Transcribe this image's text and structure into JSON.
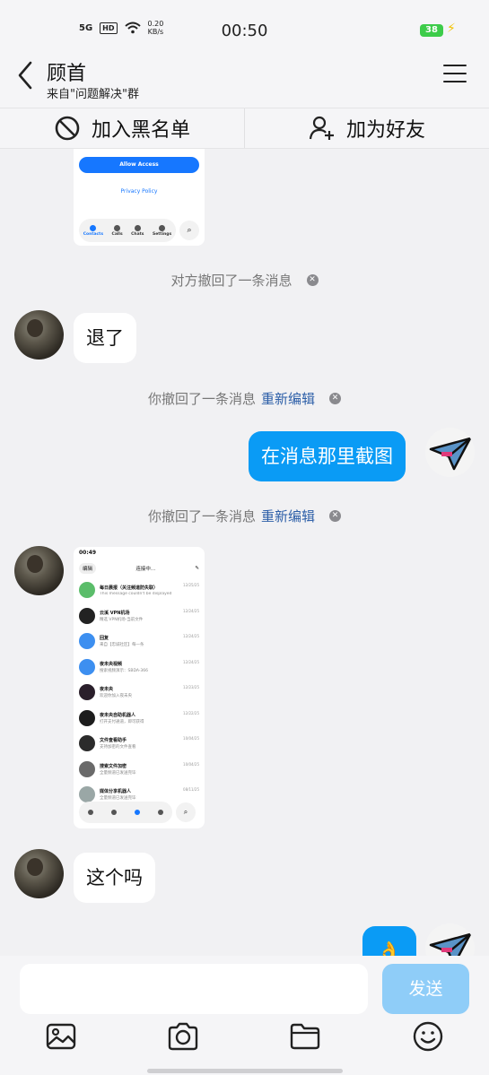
{
  "status_bar": {
    "network": "5G",
    "hd": "HD",
    "net_speed_value": "0.20",
    "net_speed_unit": "KB/s",
    "time": "00:50",
    "battery": "38"
  },
  "header": {
    "title": "顾首",
    "subtitle": "来自\"问题解决\"群"
  },
  "actions": {
    "block": "加入黑名单",
    "add_friend": "加为好友"
  },
  "messages": {
    "thumb1": {
      "allow_button": "Allow Access",
      "privacy_link": "Privacy Policy",
      "tabs": [
        "Contacts",
        "Calls",
        "Chats",
        "Settings"
      ]
    },
    "recall_other": "对方撤回了一条消息",
    "msg1": "退了",
    "recall_self_1": "你撤回了一条消息",
    "reedit_1": "重新编辑",
    "msg2": "在消息那里截图",
    "recall_self_2": "你撤回了一条消息",
    "reedit_2": "重新编辑",
    "thumb2": {
      "time": "00:49",
      "edit": "编辑",
      "connecting": "连接中...",
      "chats": [
        {
          "name": "每日晨报（关注频道防失联）",
          "preview": "This message couldn't be displayed",
          "date": "12/25/25",
          "color": "#5bbd6a"
        },
        {
          "name": "云溪 VPN机场",
          "preview": "精选 VPN机场-当前文件",
          "date": "12/24/25",
          "color": "#222222"
        },
        {
          "name": "回复",
          "preview": "来自【忠诚社区】每一条",
          "date": "12/24/25",
          "color": "#3d8ff0"
        },
        {
          "name": "夜未央视频",
          "preview": "搜索视频演示：SBDA-366",
          "date": "12/24/25",
          "color": "#3d8ff0"
        },
        {
          "name": "夜未央",
          "preview": "欢迎你加入夜未央",
          "date": "12/23/25",
          "color": "#2a1f2b"
        },
        {
          "name": "夜未央自助机器人",
          "preview": "打开支付通道，即可获得",
          "date": "12/22/25",
          "color": "#1d1d1d"
        },
        {
          "name": "文件查看助手",
          "preview": "支持加密的文件查看",
          "date": "10/04/25",
          "color": "#2b2b2b"
        },
        {
          "name": "搜索文件加密",
          "preview": "全量频道已发送完毕",
          "date": "10/04/25",
          "color": "#6a6a6a"
        },
        {
          "name": "媒体分享机器人",
          "preview": "全量频道已发送完毕",
          "date": "08/11/25",
          "color": "#9aa7a6"
        }
      ]
    },
    "msg3": "这个吗",
    "msg4": "👌"
  },
  "input": {
    "placeholder": "",
    "send": "发送"
  },
  "icons": [
    "back-arrow-icon",
    "menu-icon",
    "block-icon",
    "add-friend-icon",
    "image-icon",
    "camera-icon",
    "folder-icon",
    "emoji-icon"
  ]
}
